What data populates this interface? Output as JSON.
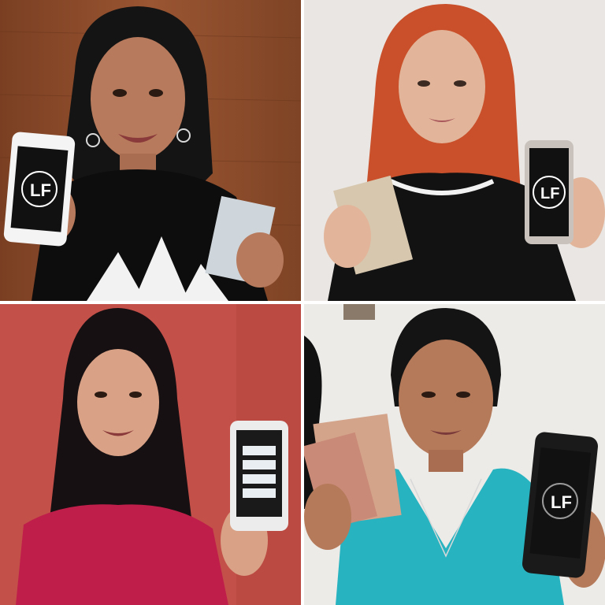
{
  "grid": {
    "panels": [
      {
        "subject": "woman-with-phone-and-banknotes",
        "background": "#8a4a2a",
        "phone_logo": "LF"
      },
      {
        "subject": "woman-with-phone-and-banknotes",
        "background": "#e9e6e3",
        "phone_logo": "LF"
      },
      {
        "subject": "woman-with-phone",
        "background": "#c4504a",
        "phone_logo": ""
      },
      {
        "subject": "woman-with-phone-and-banknotes",
        "background": "#ecebe8",
        "phone_logo": "LF"
      }
    ]
  },
  "colors": {
    "divider": "#ffffff",
    "phone_screen": "#111111",
    "hair_dark": "#141414",
    "hair_red": "#c9502a",
    "skin_1": "#b77a5c",
    "skin_2": "#e2b59a",
    "skin_3": "#d9a185",
    "skin_4": "#b57a5a"
  }
}
